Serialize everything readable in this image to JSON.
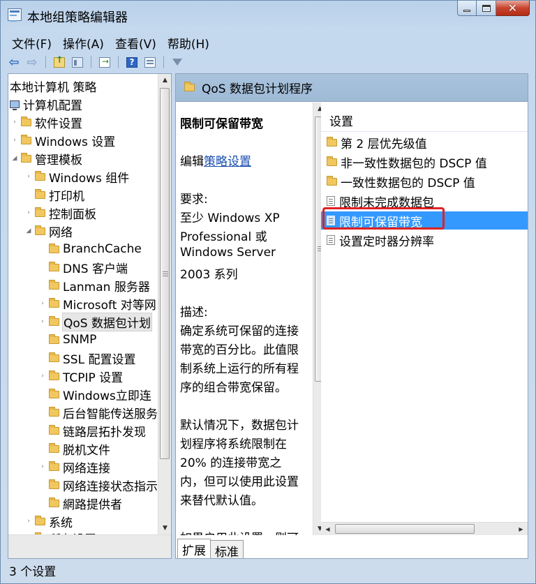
{
  "window": {
    "title": "本地组策略编辑器",
    "close_glyph": "✕"
  },
  "menu": {
    "items": [
      "文件(F)",
      "操作(A)",
      "查看(V)",
      "帮助(H)"
    ]
  },
  "tree": {
    "items": [
      {
        "label": "本地计算机 策略",
        "icon": "none"
      },
      {
        "label": "计算机配置",
        "icon": "computer-icon"
      },
      {
        "label": "软件设置",
        "icon": "folder-icon",
        "expander": "›"
      },
      {
        "label": "Windows 设置",
        "icon": "folder-icon",
        "expander": "›"
      },
      {
        "label": "管理模板",
        "icon": "folder-icon",
        "expander": "◢"
      },
      {
        "label": "Windows 组件",
        "icon": "folder-icon",
        "expander": "›"
      },
      {
        "label": "打印机",
        "icon": "folder-icon",
        "expander": ""
      },
      {
        "label": "控制面板",
        "icon": "folder-icon",
        "expander": "›"
      },
      {
        "label": "网络",
        "icon": "folder-icon",
        "expander": "◢"
      },
      {
        "label": "BranchCache",
        "icon": "folder-icon",
        "expander": ""
      },
      {
        "label": "DNS 客户端",
        "icon": "folder-icon",
        "expander": ""
      },
      {
        "label": "Lanman 服务器",
        "icon": "folder-icon",
        "expander": ""
      },
      {
        "label": "Microsoft 对等网",
        "icon": "folder-icon",
        "expander": "›"
      },
      {
        "label": "QoS 数据包计划",
        "icon": "folder-icon",
        "expander": "›"
      },
      {
        "label": "SNMP",
        "icon": "folder-icon",
        "expander": ""
      },
      {
        "label": "SSL 配置设置",
        "icon": "folder-icon",
        "expander": ""
      },
      {
        "label": "TCPIP 设置",
        "icon": "folder-icon",
        "expander": "›"
      },
      {
        "label": "Windows立即连",
        "icon": "folder-icon",
        "expander": ""
      },
      {
        "label": "后台智能传送服务",
        "icon": "folder-icon",
        "expander": ""
      },
      {
        "label": "链路层拓扑发现",
        "icon": "folder-icon",
        "expander": ""
      },
      {
        "label": "脱机文件",
        "icon": "folder-icon",
        "expander": ""
      },
      {
        "label": "网络连接",
        "icon": "folder-icon",
        "expander": "›"
      },
      {
        "label": "网络连接状态指示",
        "icon": "folder-icon",
        "expander": ""
      },
      {
        "label": "網路提供者",
        "icon": "folder-icon",
        "expander": ""
      },
      {
        "label": "系统",
        "icon": "folder-icon",
        "expander": "›"
      },
      {
        "label": "所有设置",
        "icon": "folder-icon",
        "expander": ""
      }
    ]
  },
  "right": {
    "header_title": "QoS 数据包计划程序",
    "description": {
      "title": "限制可保留带宽",
      "edit_prefix": "编辑",
      "edit_link": "策略设置",
      "lines": [
        "要求:",
        "至少 Windows XP",
        "Professional 或",
        "Windows Server",
        "2003 系列",
        "",
        "描述:",
        "确定系统可保留的连接",
        "带宽的百分比。此值限",
        "制系统上运行的所有程",
        "序的组合带宽保留。",
        "",
        "默认情况下，数据包计",
        "划程序将系统限制在",
        "20% 的连接带宽之",
        "内，但可以使用此设置",
        "来替代默认值。",
        "",
        "如果启用此设置，则可"
      ]
    },
    "list_header": "设置",
    "settings": [
      {
        "label": "第 2 层优先级值",
        "type": "folder"
      },
      {
        "label": "非一致性数据包的 DSCP 值",
        "type": "folder"
      },
      {
        "label": "一致性数据包的 DSCP 值",
        "type": "folder"
      },
      {
        "label": "限制未完成数据包",
        "type": "setting"
      },
      {
        "label": "限制可保留带宽",
        "type": "setting",
        "selected": true
      },
      {
        "label": "设置定时器分辨率",
        "type": "setting"
      }
    ],
    "tabs": [
      "扩展",
      "标准"
    ],
    "active_tab": "扩展"
  },
  "status": {
    "text": "3 个设置"
  },
  "colors": {
    "selection": "#3399ff",
    "highlight_box": "#e02020",
    "link": "#1a4fb0"
  }
}
